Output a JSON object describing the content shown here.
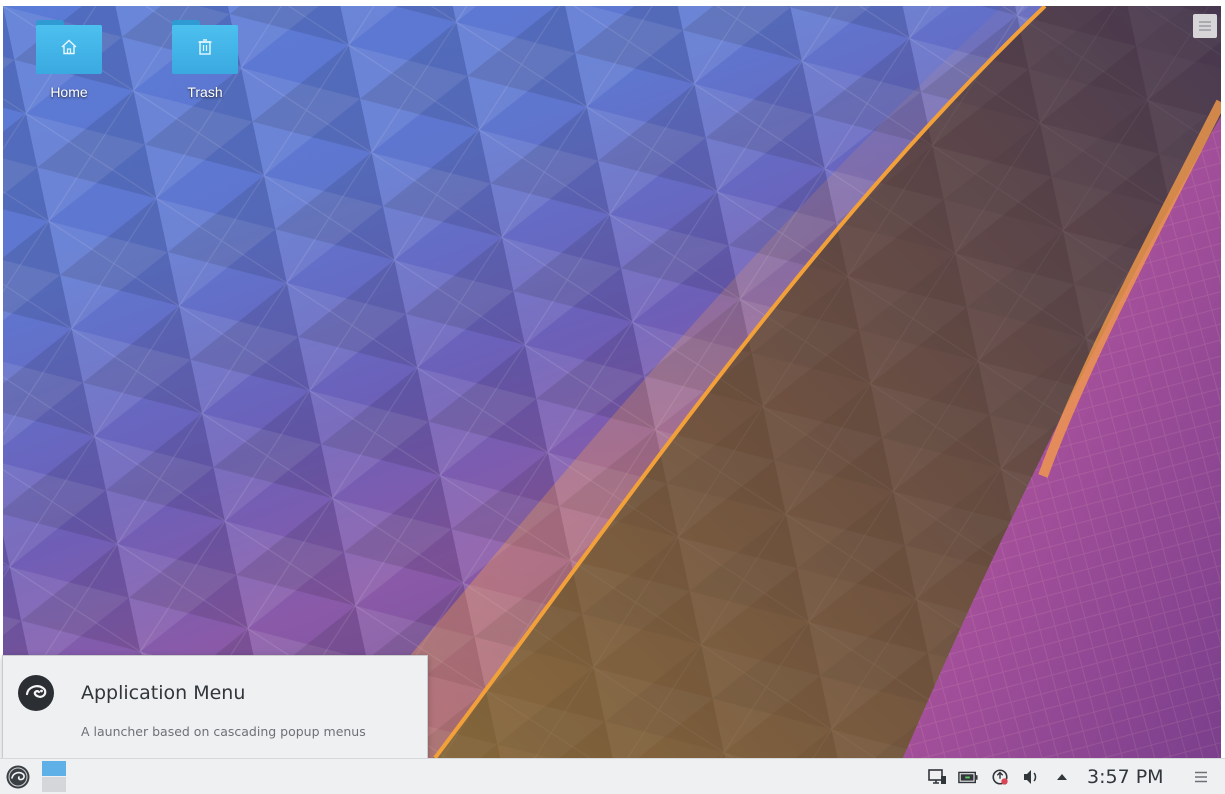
{
  "desktop": {
    "icons": [
      {
        "label": "Home",
        "icon": "home-icon"
      },
      {
        "label": "Trash",
        "icon": "trash-icon"
      }
    ],
    "toolbox_icon": "hamburger-menu-icon"
  },
  "tooltip": {
    "title": "Application Menu",
    "subtitle": "A launcher based on cascading popup menus",
    "icon": "opensuse-logo-icon"
  },
  "panel": {
    "launcher_icon": "opensuse-logo-icon",
    "virtual_desktops": 2,
    "active_desktop": 1,
    "tray": [
      {
        "icon": "display-configuration-icon"
      },
      {
        "icon": "battery-icon"
      },
      {
        "icon": "updates-icon"
      },
      {
        "icon": "volume-icon"
      },
      {
        "icon": "expand-tray-arrow-icon"
      }
    ],
    "clock": "3:57 PM",
    "menu_icon": "panel-options-icon"
  },
  "colors": {
    "folder": "#3aa9e0",
    "panel_bg": "#eff0f1",
    "text_dark": "#31363b",
    "active_desktop": "#5fb0e6",
    "wallpaper_accent": "#f2a13a"
  }
}
